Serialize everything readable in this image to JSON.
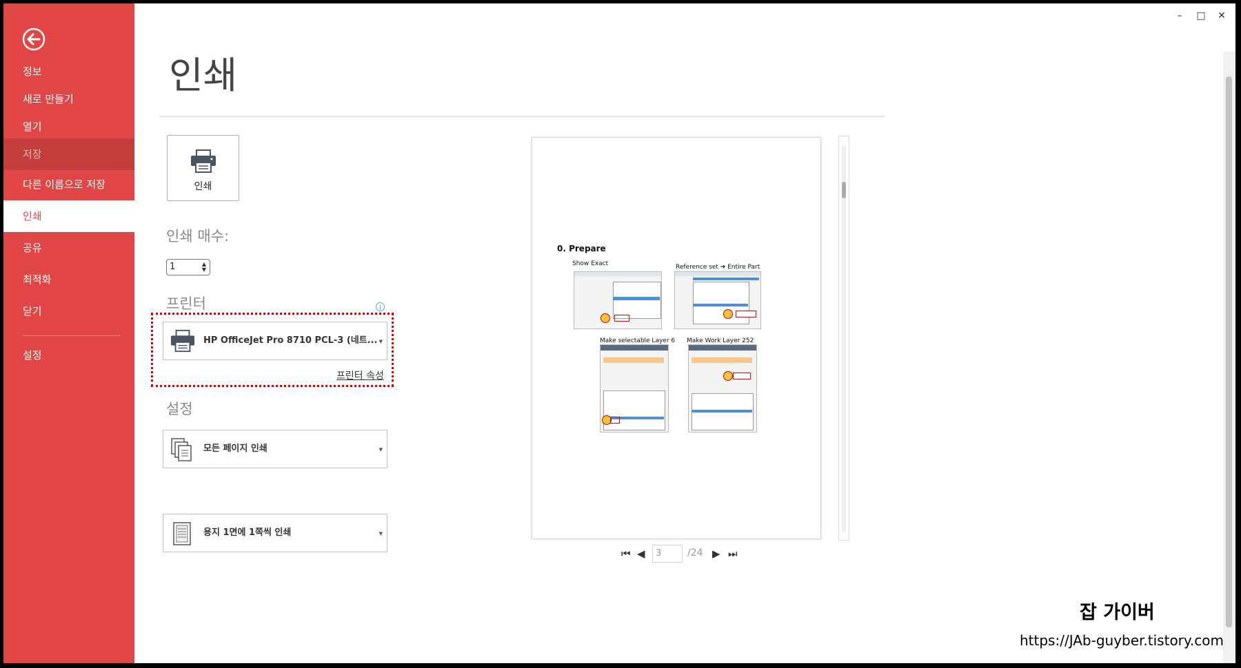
{
  "window": {
    "controls": {
      "minimize": "–",
      "maximize": "□",
      "close": "✕"
    }
  },
  "sidebar": {
    "back_icon": "back-arrow-icon",
    "items": [
      {
        "label": "정보",
        "state": "normal"
      },
      {
        "label": "새로 만들기",
        "state": "normal"
      },
      {
        "label": "열기",
        "state": "normal"
      },
      {
        "label": "저장",
        "state": "disabled"
      },
      {
        "label": "다른 이름으로 저장",
        "state": "normal"
      },
      {
        "label": "인쇄",
        "state": "active"
      },
      {
        "label": "공유",
        "state": "normal"
      },
      {
        "label": "최적화",
        "state": "normal"
      },
      {
        "label": "닫기",
        "state": "normal"
      },
      {
        "label": "설정",
        "state": "normal"
      }
    ]
  },
  "main": {
    "title": "인쇄",
    "print_button": {
      "label": "인쇄",
      "icon": "printer-icon"
    },
    "copies": {
      "label": "인쇄 매수:",
      "value": "1"
    },
    "printer": {
      "label": "프린터",
      "selected": "HP OfficeJet Pro 8710 PCL-3 (네트...",
      "properties_link": "프린터 속성",
      "info_icon": "info-icon"
    },
    "settings": {
      "label": "설정",
      "pages_option": "모든 페이지 인쇄",
      "per_sheet_option": "용지 1면에 1쪽씩 인쇄"
    }
  },
  "preview": {
    "page_heading": "0. Prepare",
    "captions": [
      "Show Exact",
      "Reference set ➔ Entire Part",
      "Make selectable Layer 6",
      "Make Work Layer 252"
    ],
    "current_page": "3",
    "total_pages": "/24"
  },
  "watermark": {
    "brand": "잡 가이버",
    "url": "https://JAb-guyber.tistory.com"
  },
  "colors": {
    "accent": "#e04646",
    "accent_dark": "#c43d3d",
    "highlight": "#d40000"
  }
}
